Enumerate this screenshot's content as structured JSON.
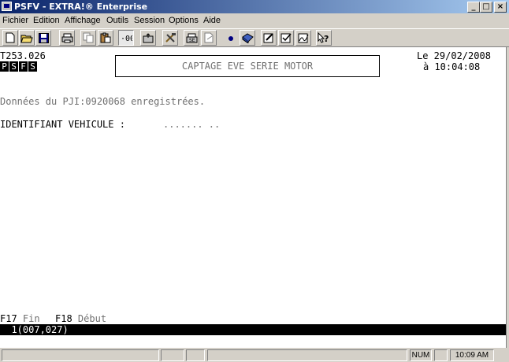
{
  "window": {
    "title": "PSFV - EXTRA!® Enterprise"
  },
  "window_controls": {
    "minimize": "_",
    "maximize": "□",
    "close": "×"
  },
  "menu": [
    {
      "label": "Fichier"
    },
    {
      "label": "Edition"
    },
    {
      "label": "Affichage"
    },
    {
      "label": "Outils"
    },
    {
      "label": "Session"
    },
    {
      "label": "Options"
    },
    {
      "label": "Aide"
    }
  ],
  "toolbar": {
    "icons": [
      "new-icon",
      "open-icon",
      "save-icon",
      "print-icon",
      "copy-icon",
      "paste-icon",
      "record-icon",
      "transfer-icon",
      "tools-icon",
      "printer-setup-icon",
      "send-icon",
      "dot-icon",
      "book-icon",
      "edit-form-icon",
      "check-form-icon",
      "sign-icon",
      "help-icon"
    ]
  },
  "screen": {
    "program_id": "T253.026",
    "flags": [
      "P",
      "S",
      "F",
      "S"
    ],
    "title": "CAPTAGE EVE SERIE MOTOR",
    "date_label": "Le 29/02/2008",
    "time_label": "à 10:04:08",
    "message": "Données du PJI:0920068 enregistrées.",
    "vehicle_label": "IDENTIFIANT VEHICULE :",
    "vehicle_value": "....... ..",
    "fkeys": [
      {
        "key": "F17",
        "label": "Fin"
      },
      {
        "key": "F18",
        "label": "Début"
      }
    ],
    "command_line": "  1(007,027)"
  },
  "statusbar": {
    "num": "NUM",
    "clock": "10:09 AM"
  },
  "colors": {
    "titlebar_start": "#0a246a",
    "titlebar_end": "#a6caf0",
    "chrome": "#d4d0c8",
    "screen_bg": "#ffffff",
    "dim_text": "#707070"
  }
}
